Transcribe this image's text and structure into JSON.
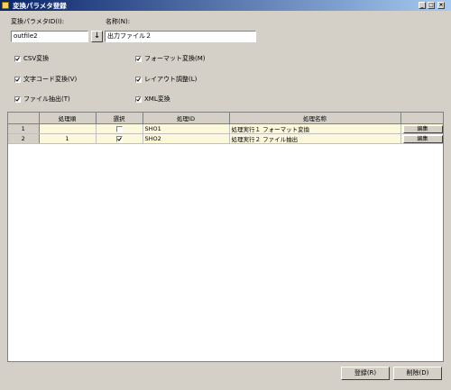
{
  "window": {
    "title": "変換パラメタ登録",
    "controls": [
      "_",
      "□",
      "×"
    ]
  },
  "form": {
    "param_id_label": "変換パラメタID(I):",
    "param_id_value": "outfile2",
    "download_icon": "↓",
    "name_label": "名称(N):",
    "name_value": "出力ファイル２"
  },
  "options": [
    {
      "label": "CSV変換",
      "checked": true
    },
    {
      "label": "フォーマット変換(M)",
      "checked": true
    },
    {
      "label": "文字コード変換(V)",
      "checked": true
    },
    {
      "label": "レイアウト調整(L)",
      "checked": true
    },
    {
      "label": "ファイル抽出(T)",
      "checked": true
    },
    {
      "label": "XML変換",
      "checked": true
    }
  ],
  "table": {
    "headers": [
      "",
      "処理順",
      "選択",
      "処理ID",
      "処理名称",
      ""
    ],
    "rows": [
      {
        "num": "1",
        "order": "",
        "selected": false,
        "id": "SHO1",
        "name": "処理実行１ フォーマット変換",
        "action": "編集"
      },
      {
        "num": "2",
        "order": "1",
        "selected": true,
        "id": "SHO2",
        "name": "処理実行２ ファイル抽出",
        "action": "編集"
      }
    ]
  },
  "footer": {
    "register_label": "登録(R)",
    "delete_label": "削除(D)"
  }
}
